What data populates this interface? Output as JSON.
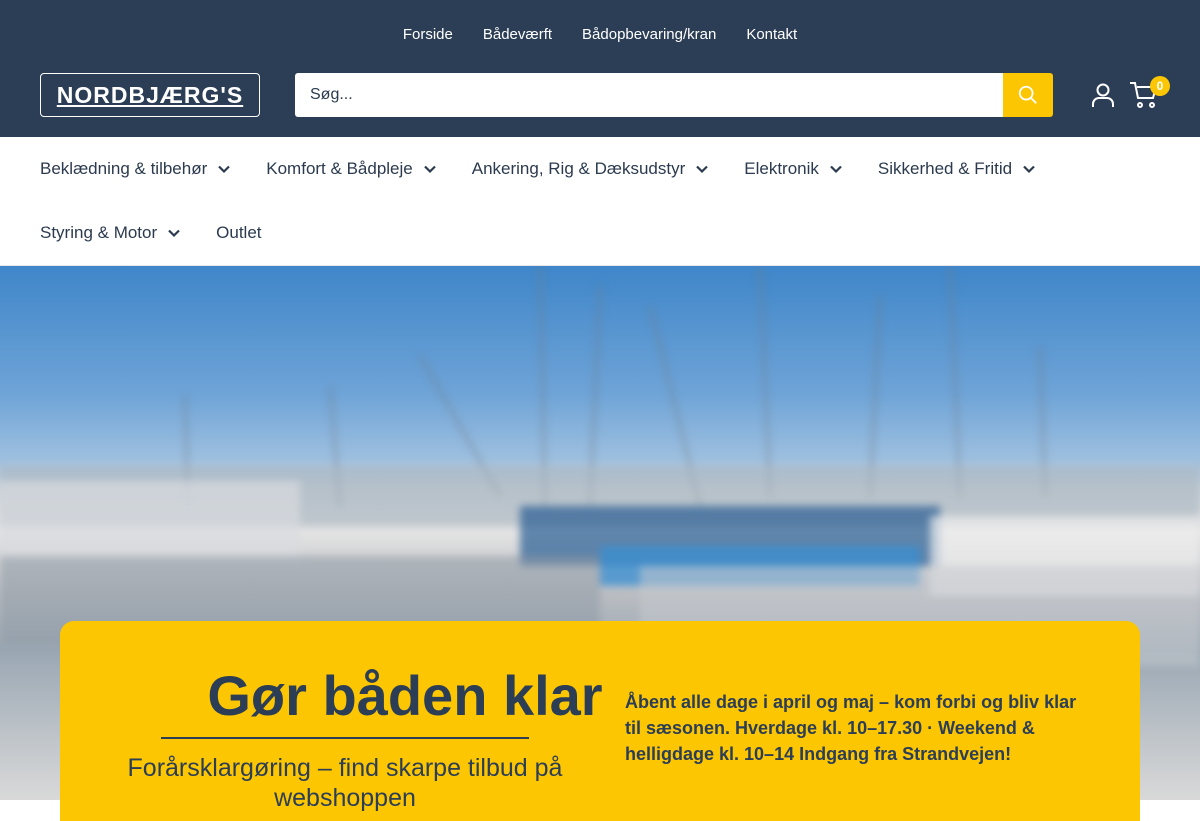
{
  "colors": {
    "header_bg": "#2c3e55",
    "accent": "#fdc602",
    "text": "#2b3a4e",
    "white": "#ffffff"
  },
  "util_nav": [
    {
      "label": "Forside"
    },
    {
      "label": "Bådeværft"
    },
    {
      "label": "Bådopbevaring/kran"
    },
    {
      "label": "Kontakt"
    }
  ],
  "logo": {
    "text": "NORDBJÆRG'S"
  },
  "search": {
    "placeholder": "Søg...",
    "value": "",
    "icon": "search-icon"
  },
  "header_icons": {
    "account": "user-icon",
    "cart": "cart-icon"
  },
  "cart": {
    "count": "0"
  },
  "main_nav": [
    {
      "label": "Beklædning & tilbehør",
      "has_dropdown": true
    },
    {
      "label": "Komfort & Bådpleje",
      "has_dropdown": true
    },
    {
      "label": "Ankering, Rig & Dæksudstyr",
      "has_dropdown": true
    },
    {
      "label": "Elektronik",
      "has_dropdown": true
    },
    {
      "label": "Sikkerhed & Fritid",
      "has_dropdown": true
    },
    {
      "label": "Styring & Motor",
      "has_dropdown": true
    },
    {
      "label": "Outlet",
      "has_dropdown": false
    }
  ],
  "promo": {
    "title": "Gør båden klar",
    "subtitle": "Forårsklargøring – find skarpe tilbud på webshoppen",
    "text": "Åbent alle dage i april og maj – kom forbi og bliv klar til sæsonen. Hverdage kl. 10–17.30 · Weekend & helligdage kl. 10–14 Indgang fra Strandvejen!"
  }
}
